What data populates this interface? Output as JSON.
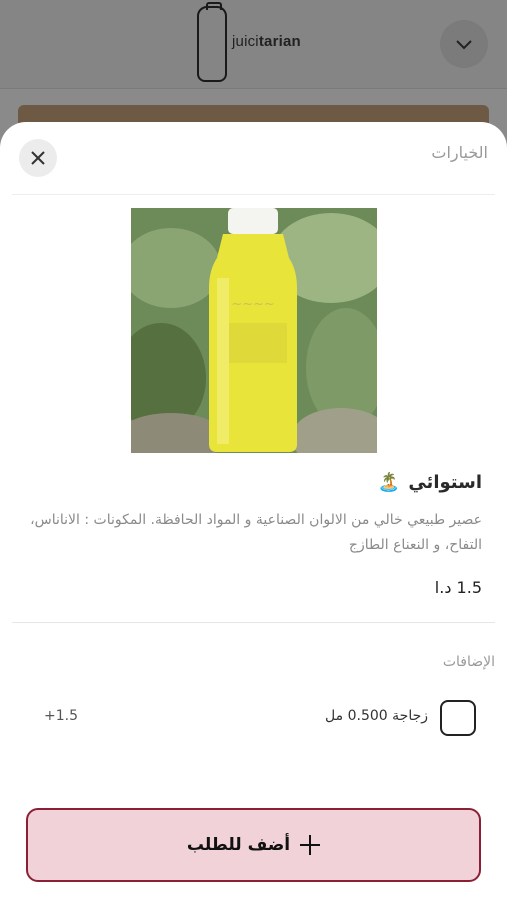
{
  "header": {
    "logo_text_light": "juici",
    "logo_text_bold": "tarian",
    "chevron_icon": "chevron-down-icon"
  },
  "sheet": {
    "title": "الخيارات",
    "close_icon": "close-icon"
  },
  "product": {
    "name": "استوائي",
    "name_emoji": "🏝️",
    "description": "عصير طبيعي خالي من الالوان الصناعية و المواد الحافظة. المكونات : الاناناس، التفاح، و النعناع الطازج",
    "price": "1.5 د.ا",
    "image_alt": "tropical juice bottle"
  },
  "addons": {
    "title": "الإضافات",
    "items": [
      {
        "label": "زجاجة 0.500 مل",
        "price": "+1.5",
        "checked": false
      }
    ]
  },
  "actions": {
    "add_label": "أضف للطلب"
  },
  "colors": {
    "accent_border": "#8b2035",
    "accent_fill": "#f2d2d9"
  }
}
